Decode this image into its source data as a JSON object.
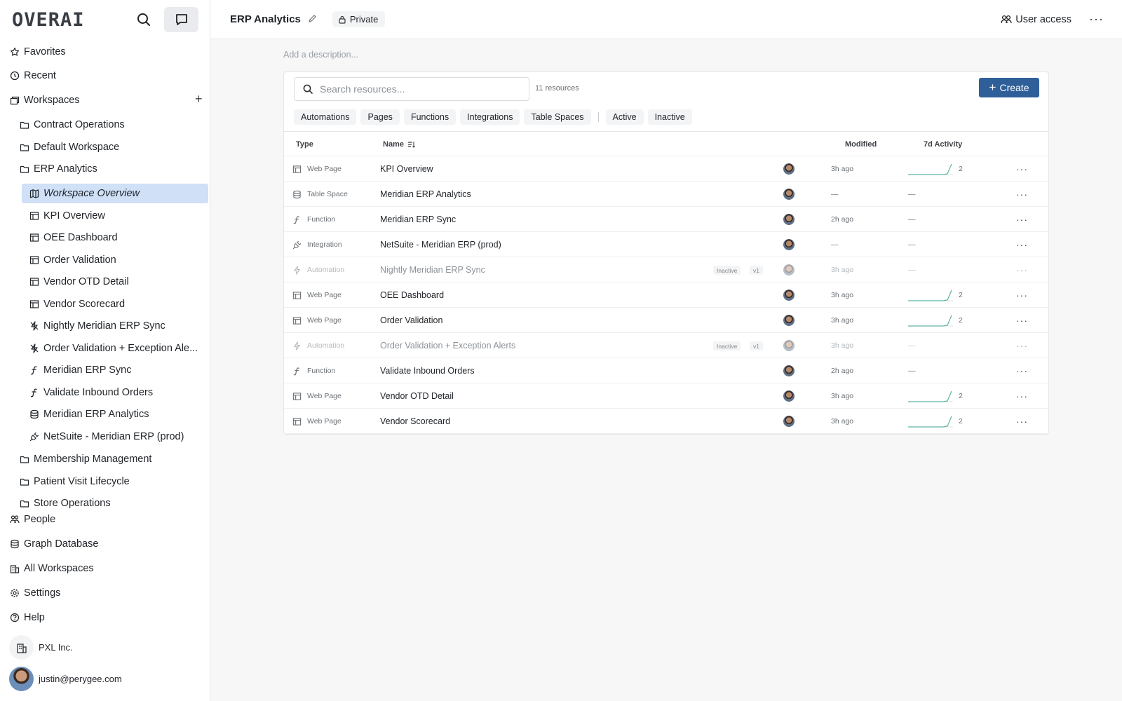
{
  "app": {
    "logo": "OVERAI"
  },
  "sidebar": {
    "top_nav": [
      {
        "label": "Favorites",
        "icon": "star-icon"
      },
      {
        "label": "Recent",
        "icon": "clock-icon"
      },
      {
        "label": "Workspaces",
        "icon": "workspaces-icon"
      }
    ],
    "workspaces": [
      {
        "label": "Contract Operations",
        "icon": "folder-icon"
      },
      {
        "label": "Default Workspace",
        "icon": "folder-icon"
      },
      {
        "label": "ERP Analytics",
        "icon": "folder-icon"
      }
    ],
    "erp_children": [
      {
        "label": "Workspace Overview",
        "icon": "map-icon",
        "selected": true
      },
      {
        "label": "KPI Overview",
        "icon": "webpage-icon"
      },
      {
        "label": "OEE Dashboard",
        "icon": "webpage-icon"
      },
      {
        "label": "Order Validation",
        "icon": "webpage-icon"
      },
      {
        "label": "Vendor OTD Detail",
        "icon": "webpage-icon"
      },
      {
        "label": "Vendor Scorecard",
        "icon": "webpage-icon"
      },
      {
        "label": "Nightly Meridian ERP Sync",
        "icon": "automation-off-icon"
      },
      {
        "label": "Order Validation + Exception Ale...",
        "icon": "automation-off-icon"
      },
      {
        "label": "Meridian ERP Sync",
        "icon": "function-icon"
      },
      {
        "label": "Validate Inbound Orders",
        "icon": "function-icon"
      },
      {
        "label": "Meridian ERP Analytics",
        "icon": "database-icon"
      },
      {
        "label": "NetSuite - Meridian ERP (prod)",
        "icon": "plug-icon"
      }
    ],
    "more_workspaces": [
      {
        "label": "Membership Management",
        "icon": "folder-icon"
      },
      {
        "label": "Patient Visit Lifecycle",
        "icon": "folder-icon"
      },
      {
        "label": "Store Operations",
        "icon": "folder-icon"
      }
    ],
    "bottom_nav": [
      {
        "label": "People",
        "icon": "people-icon"
      },
      {
        "label": "Graph Database",
        "icon": "database-icon"
      },
      {
        "label": "All Workspaces",
        "icon": "building-icon"
      },
      {
        "label": "Settings",
        "icon": "gear-icon"
      },
      {
        "label": "Help",
        "icon": "help-icon"
      }
    ],
    "org": "PXL Inc.",
    "user_email": "justin@perygee.com"
  },
  "header": {
    "title": "ERP Analytics",
    "visibility": "Private",
    "user_access": "User access"
  },
  "main": {
    "description_placeholder": "Add a description...",
    "search_placeholder": "Search resources...",
    "resource_count": "11 resources",
    "create_label": "Create",
    "type_filters": [
      "Automations",
      "Pages",
      "Functions",
      "Integrations",
      "Table Spaces"
    ],
    "status_filters": [
      "Active",
      "Inactive"
    ],
    "columns": {
      "type": "Type",
      "name": "Name",
      "modified": "Modified",
      "activity": "7d Activity"
    },
    "rows": [
      {
        "type": "Web Page",
        "icon": "webpage-icon",
        "name": "KPI Overview",
        "modified": "3h ago",
        "activity": "2",
        "inactive": false
      },
      {
        "type": "Table Space",
        "icon": "database-icon",
        "name": "Meridian ERP Analytics",
        "modified": "—",
        "activity": "—",
        "inactive": false
      },
      {
        "type": "Function",
        "icon": "function-icon",
        "name": "Meridian ERP Sync",
        "modified": "2h ago",
        "activity": "—",
        "inactive": false
      },
      {
        "type": "Integration",
        "icon": "plug-icon",
        "name": "NetSuite - Meridian ERP (prod)",
        "modified": "—",
        "activity": "—",
        "inactive": false
      },
      {
        "type": "Automation",
        "icon": "lightning-icon",
        "name": "Nightly Meridian ERP Sync",
        "status": "Inactive",
        "version": "v1",
        "modified": "3h ago",
        "activity": "—",
        "inactive": true
      },
      {
        "type": "Web Page",
        "icon": "webpage-icon",
        "name": "OEE Dashboard",
        "modified": "3h ago",
        "activity": "2",
        "inactive": false
      },
      {
        "type": "Web Page",
        "icon": "webpage-icon",
        "name": "Order Validation",
        "modified": "3h ago",
        "activity": "2",
        "inactive": false
      },
      {
        "type": "Automation",
        "icon": "lightning-icon",
        "name": "Order Validation + Exception Alerts",
        "status": "Inactive",
        "version": "v1",
        "modified": "3h ago",
        "activity": "—",
        "inactive": true
      },
      {
        "type": "Function",
        "icon": "function-icon",
        "name": "Validate Inbound Orders",
        "modified": "2h ago",
        "activity": "—",
        "inactive": false
      },
      {
        "type": "Web Page",
        "icon": "webpage-icon",
        "name": "Vendor OTD Detail",
        "modified": "3h ago",
        "activity": "2",
        "inactive": false
      },
      {
        "type": "Web Page",
        "icon": "webpage-icon",
        "name": "Vendor Scorecard",
        "modified": "3h ago",
        "activity": "2",
        "inactive": false
      }
    ]
  },
  "colors": {
    "accent": "#2f5f98",
    "selected_bg": "#cfe0f7",
    "sparkline": "#5fb3a3"
  }
}
